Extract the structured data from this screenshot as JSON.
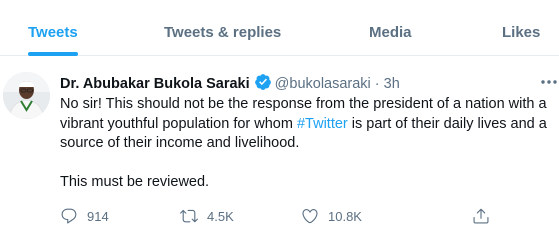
{
  "tabs": [
    {
      "label": "Tweets",
      "active": true
    },
    {
      "label": "Tweets & replies",
      "active": false
    },
    {
      "label": "Media",
      "active": false
    },
    {
      "label": "Likes",
      "active": false
    }
  ],
  "tweet": {
    "author": {
      "display_name": "Dr. Abubakar Bukola Saraki",
      "handle": "@bukolasaraki",
      "verified": true,
      "avatar_icon": "profile-photo"
    },
    "separator": "·",
    "timestamp": "3h",
    "text": {
      "before_hashtag": "No sir! This should not be the response from the president of a nation with a vibrant youthful population for whom ",
      "hashtag": "#Twitter",
      "after_hashtag": " is part of their daily lives and a source of their income and livelihood.",
      "second_paragraph": "This must be reviewed."
    },
    "actions": {
      "reply": {
        "icon": "reply-icon",
        "count": "914"
      },
      "retweet": {
        "icon": "retweet-icon",
        "count": "4.5K"
      },
      "like": {
        "icon": "heart-icon",
        "count": "10.8K"
      },
      "share": {
        "icon": "share-icon"
      }
    }
  },
  "colors": {
    "accent": "#1da1f2",
    "secondary_text": "#5b7083",
    "primary_text": "#0f1419",
    "divider": "#e6ecf0"
  }
}
